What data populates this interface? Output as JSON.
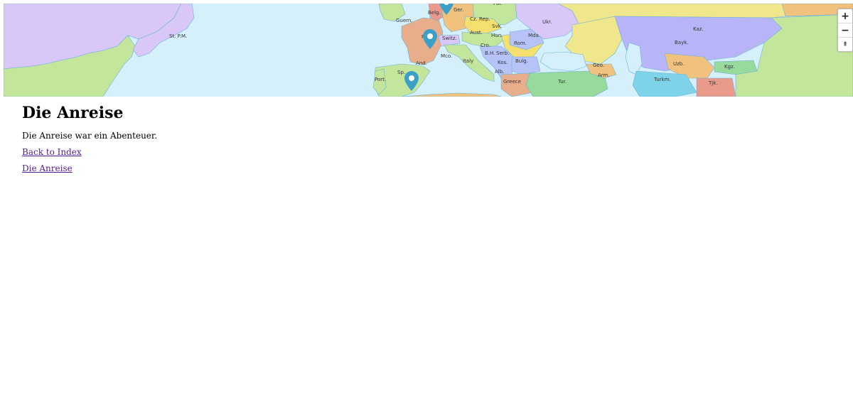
{
  "map": {
    "labels": [
      {
        "name": "st-pm",
        "text": "St. P.M."
      },
      {
        "name": "guern",
        "text": "Guern."
      },
      {
        "name": "belg",
        "text": "Belg."
      },
      {
        "name": "ger",
        "text": "Ger."
      },
      {
        "name": "pol",
        "text": "Pol."
      },
      {
        "name": "cz",
        "text": "Cz. Rep."
      },
      {
        "name": "ukr",
        "text": "Ukr."
      },
      {
        "name": "kaz",
        "text": "Kaz."
      },
      {
        "name": "slvk",
        "text": "Svk."
      },
      {
        "name": "aust",
        "text": "Aust."
      },
      {
        "name": "hun",
        "text": "Hun."
      },
      {
        "name": "mda",
        "text": "Mda."
      },
      {
        "name": "switz",
        "text": "Switz."
      },
      {
        "name": "fr",
        "text": "Fr."
      },
      {
        "name": "rom",
        "text": "Rom."
      },
      {
        "name": "bayk",
        "text": "Bayk."
      },
      {
        "name": "mco",
        "text": "Mco."
      },
      {
        "name": "cro",
        "text": "Cro."
      },
      {
        "name": "bh",
        "text": "B.H."
      },
      {
        "name": "serb",
        "text": "Serb."
      },
      {
        "name": "and",
        "text": "And."
      },
      {
        "name": "italy",
        "text": "Italy"
      },
      {
        "name": "kos",
        "text": "Kos."
      },
      {
        "name": "bulg",
        "text": "Bulg."
      },
      {
        "name": "geo",
        "text": "Geo."
      },
      {
        "name": "uzb",
        "text": "Uzb."
      },
      {
        "name": "kgz",
        "text": "Kgz."
      },
      {
        "name": "sp",
        "text": "Sp."
      },
      {
        "name": "alb",
        "text": "Alb."
      },
      {
        "name": "arm",
        "text": "Arm."
      },
      {
        "name": "port",
        "text": "Port."
      },
      {
        "name": "greece",
        "text": "Greece"
      },
      {
        "name": "tur",
        "text": "Tur."
      },
      {
        "name": "turkm",
        "text": "Turkm."
      },
      {
        "name": "tjk",
        "text": "Tjk."
      }
    ],
    "zoom_in_label": "+",
    "zoom_out_label": "−",
    "reset_label": "⇞"
  },
  "page": {
    "title": "Die Anreise",
    "body": "Die Anreise war ein Abenteuer.",
    "links": [
      {
        "label": "Back to Index"
      },
      {
        "label": "Die Anreise"
      }
    ]
  },
  "colors": {
    "marker": "#3aa0c8",
    "sea": "#d6f0fb",
    "link": "#551a8b"
  }
}
